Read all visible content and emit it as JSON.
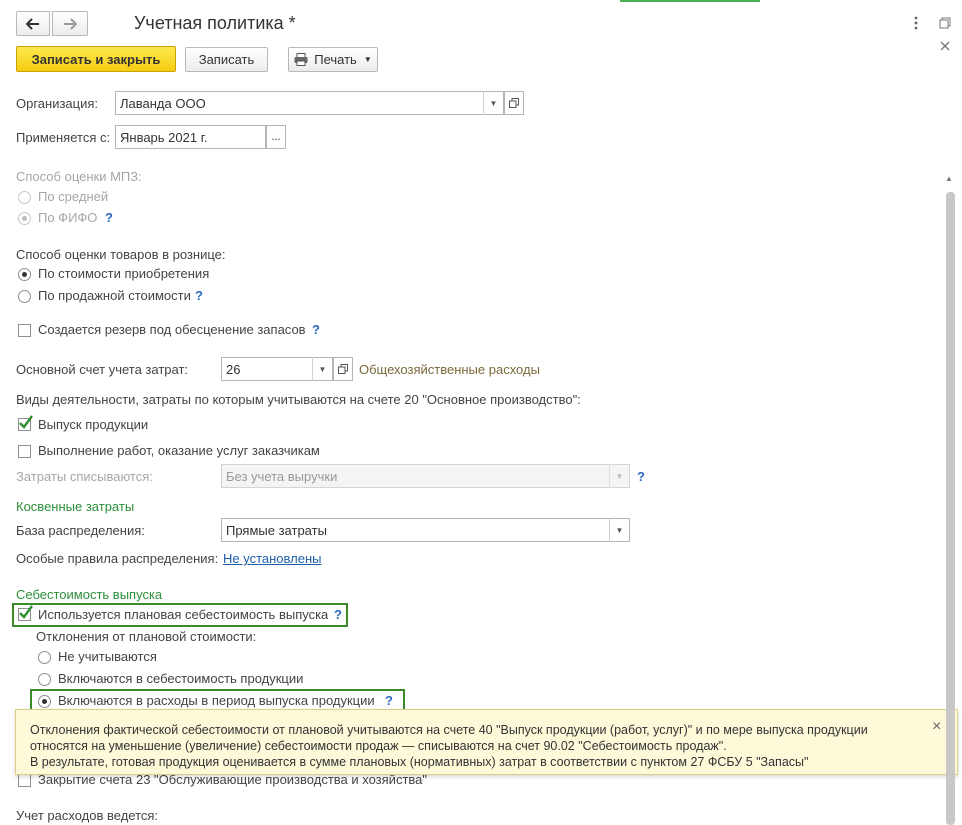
{
  "header": {
    "title": "Учетная политика *",
    "back_icon": "arrow-left-icon",
    "forward_icon": "arrow-right-icon",
    "menu_icon": "more-vertical-icon",
    "restore_icon": "restore-window-icon",
    "close_icon": "close-icon",
    "accent_tab_color": "#4caf50"
  },
  "toolbar": {
    "save_close_label": "Записать и закрыть",
    "save_label": "Записать",
    "print_label": "Печать"
  },
  "form": {
    "org_label": "Организация:",
    "org_value": "Лаванда ООО",
    "applies_label": "Применяется с:",
    "applies_value": "Январь 2021 г.",
    "applies_btn": "...",
    "mpz_label": "Способ оценки МПЗ:",
    "mpz_opt1": "По средней",
    "mpz_opt2": "По ФИФО",
    "retail_label": "Способ оценки товаров в рознице:",
    "retail_opt1": "По стоимости приобретения",
    "retail_opt2": "По продажной стоимости",
    "reserve_label": "Создается резерв под обесценение запасов",
    "cost_account_label": "Основной счет учета затрат:",
    "cost_account_value": "26",
    "cost_account_desc": "Общехозяйственные расходы",
    "activities_label": "Виды деятельности, затраты по которым учитываются на счете 20 \"Основное производство\":",
    "activity1": "Выпуск продукции",
    "activity2": "Выполнение работ, оказание услуг заказчикам",
    "writeoff_label": "Затраты списываются:",
    "writeoff_value": "Без учета выручки",
    "indirect_header": "Косвенные затраты",
    "base_label": "База распределения:",
    "base_value": "Прямые затраты",
    "rules_label": "Особые правила распределения:",
    "rules_link": "Не установлены",
    "cost_header": "Себестоимость выпуска",
    "planned_label": "Используется плановая себестоимость выпуска",
    "deviation_label": "Отклонения от плановой стоимости:",
    "dev_opt1": "Не учитываются",
    "dev_opt2": "Включаются в себестоимость продукции",
    "dev_opt3": "Включаются в расходы в период выпуска продукции",
    "closing_label": "Закрытие счета 23 \"Обслуживающие производства и хозяйства\"",
    "expenses_label": "Учет расходов ведется:",
    "help": "?"
  },
  "tooltip": {
    "line1": "Отклонения фактической себестоимости от плановой учитываются на счете 40 \"Выпуск продукции (работ, услуг)\" и по мере выпуска продукции",
    "line2": "относятся на уменьшение (увеличение) себестоимости продаж — списываются на счет 90.02 \"Себестоимость продаж\".",
    "line3": "В результате, готовая продукция оценивается в сумме плановых (нормативных) затрат в соответствии с пунктом 27 ФСБУ 5 \"Запасы\"",
    "close": "×"
  }
}
